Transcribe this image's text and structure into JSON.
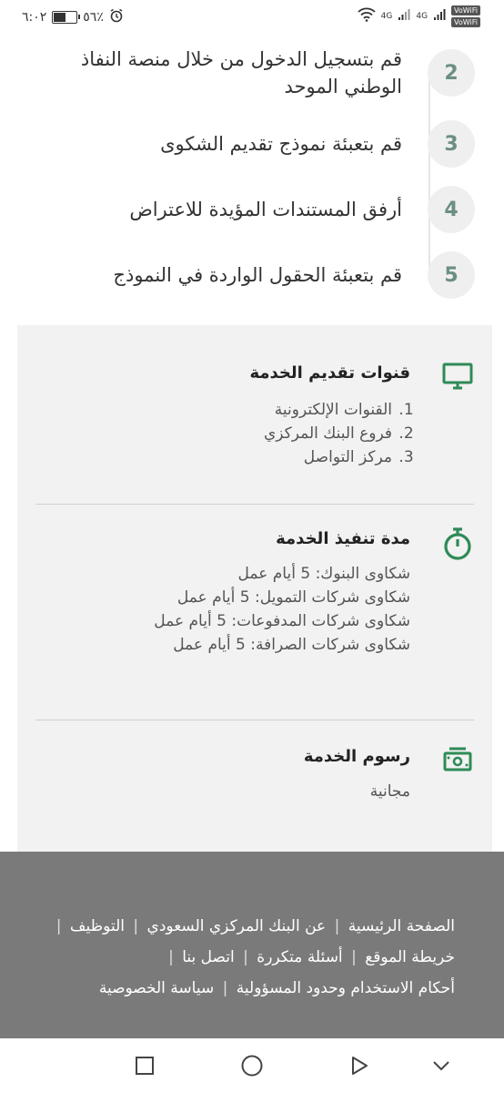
{
  "status_bar": {
    "time": "٦:٠٢",
    "battery_percent": "٥٦٪",
    "battery_level": 0.56,
    "network_labels": [
      "4G",
      "4G"
    ],
    "vowifi_labels": [
      "VoWiFi",
      "VoWiFi"
    ]
  },
  "steps": [
    {
      "number": "2",
      "text": "قم بتسجيل الدخول من خلال منصة النفاذ الوطني الموحد"
    },
    {
      "number": "3",
      "text": "قم بتعبئة نموذج تقديم الشكوى"
    },
    {
      "number": "4",
      "text": "أرفق المستندات المؤيدة للاعتراض"
    },
    {
      "number": "5",
      "text": "قم بتعبئة الحقول الواردة في النموذج"
    }
  ],
  "channels": {
    "title": "قنوات تقديم الخدمة",
    "items": [
      "القنوات الإلكترونية",
      "فروع البنك المركزي",
      "مركز التواصل"
    ],
    "icon": "monitor-icon"
  },
  "duration": {
    "title": "مدة تنفيذ الخدمة",
    "items": [
      "شكاوى البنوك: 5 أيام عمل",
      "شكاوى شركات التمويل: 5 أيام عمل",
      "شكاوى شركات المدفوعات: 5 أيام عمل",
      "شكاوى شركات الصرافة: 5 أيام عمل"
    ],
    "icon": "stopwatch-icon"
  },
  "fees": {
    "title": "رسوم الخدمة",
    "value": "مجانية",
    "icon": "cash-icon"
  },
  "footer": {
    "links": {
      "home": "الصفحة الرئيسية",
      "about": "عن البنك المركزي السعودي",
      "jobs": "التوظيف",
      "sitemap": "خريطة الموقع",
      "faq": "أسئلة متكررة",
      "contact": "اتصل بنا",
      "terms": "أحكام الاستخدام وحدود المسؤولية",
      "privacy": "سياسة الخصوصية"
    },
    "separator": "|"
  },
  "colors": {
    "accent_green": "#2e8b57",
    "step_number": "#6a8f80",
    "footer_bg": "#7a7a7a"
  }
}
